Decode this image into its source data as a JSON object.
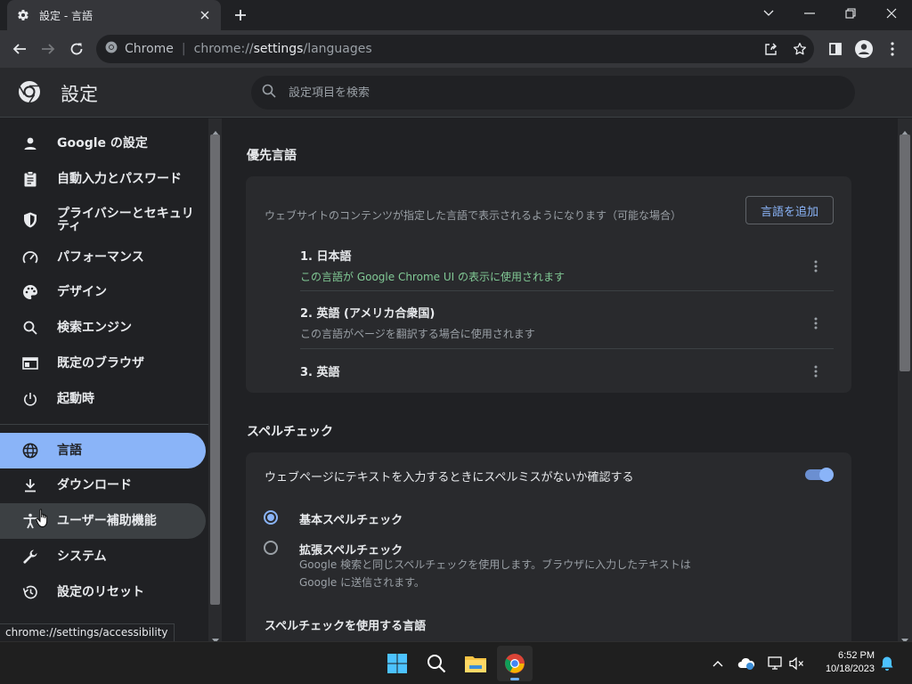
{
  "tab": {
    "title": "設定 - 言語"
  },
  "omnibox": {
    "site_chip": "Chrome",
    "separator": "|",
    "url_scheme": "chrome://",
    "url_host": "settings",
    "url_path": "/languages"
  },
  "header": {
    "title": "設定",
    "search_placeholder": "設定項目を検索"
  },
  "sidebar": {
    "items": [
      {
        "label": "Google の設定"
      },
      {
        "label": "自動入力とパスワード"
      },
      {
        "label": "プライバシーとセキュリティ"
      },
      {
        "label": "パフォーマンス"
      },
      {
        "label": "デザイン"
      },
      {
        "label": "検索エンジン"
      },
      {
        "label": "既定のブラウザ"
      },
      {
        "label": "起動時"
      },
      {
        "label": "言語"
      },
      {
        "label": "ダウンロード"
      },
      {
        "label": "ユーザー補助機能"
      },
      {
        "label": "システム"
      },
      {
        "label": "設定のリセット"
      }
    ]
  },
  "status_url": "chrome://settings/accessibility",
  "main": {
    "preferred": {
      "title": "優先言語",
      "description": "ウェブサイトのコンテンツが指定した言語で表示されるようになります（可能な場合）",
      "add_button": "言語を追加",
      "languages": [
        {
          "name": "1. 日本語",
          "sub": "この言語が Google Chrome UI の表示に使用されます"
        },
        {
          "name": "2. 英語 (アメリカ合衆国)",
          "sub": "この言語がページを翻訳する場合に使用されます"
        },
        {
          "name": "3. 英語",
          "sub": ""
        }
      ]
    },
    "spellcheck": {
      "title": "スペルチェック",
      "toggle_label": "ウェブページにテキストを入力するときにスペルミスがないか確認する",
      "toggle_on": true,
      "basic_label": "基本スペルチェック",
      "enhanced_label": "拡張スペルチェック",
      "enhanced_desc": "Google 検索と同じスペルチェックを使用します。ブラウザに入力したテキストは Google に送信されます。",
      "languages_title": "スペルチェックを使用する言語"
    }
  },
  "taskbar": {
    "time": "6:52 PM",
    "date": "10/18/2023"
  },
  "colors": {
    "accent": "#8ab4f8",
    "green": "#81c995",
    "bg": "#202124",
    "card": "#292a2d"
  }
}
